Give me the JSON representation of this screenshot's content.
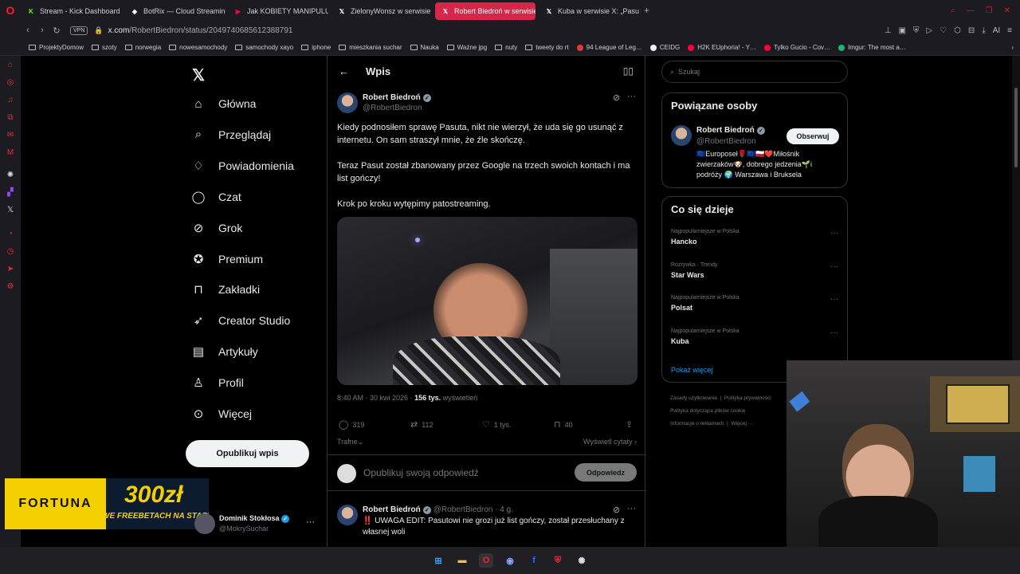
{
  "browser": {
    "tabs": [
      {
        "title": "Stream - Kick Dashboard",
        "icon": "kick-icon",
        "color": "#53fc18",
        "glyph": "K"
      },
      {
        "title": "BotRix — Cloud Streaming",
        "icon": "botrix-icon",
        "color": "#ffffff",
        "glyph": "◈"
      },
      {
        "title": "Jak KOBIETY MANIPULU…",
        "icon": "youtube-icon",
        "color": "#ff0033",
        "glyph": "▶"
      },
      {
        "title": "ZielonyWonsz w serwisie",
        "icon": "x-icon",
        "color": "#ffffff",
        "glyph": "𝕏"
      },
      {
        "title": "Robert Biedroń w serwisie",
        "icon": "x-icon",
        "color": "#ffffff",
        "glyph": "𝕏"
      },
      {
        "title": "Kuba w serwisie X: „Pasut",
        "icon": "x-icon",
        "color": "#ffffff",
        "glyph": "𝕏"
      }
    ],
    "vpn": "VPN",
    "url_host": "x.com",
    "url_path": "/RobertBiedron/status/2049740685612388791",
    "ai_label": "AI",
    "bookmarks": [
      {
        "label": "ProjektyDomow",
        "kind": "folder"
      },
      {
        "label": "szoty",
        "kind": "folder"
      },
      {
        "label": "norwegia",
        "kind": "folder"
      },
      {
        "label": "nowesamochody",
        "kind": "folder"
      },
      {
        "label": "samochody xayo",
        "kind": "folder"
      },
      {
        "label": "iphone",
        "kind": "folder"
      },
      {
        "label": "mieszkania suchar",
        "kind": "folder"
      },
      {
        "label": "Nauka",
        "kind": "folder"
      },
      {
        "label": "Ważne jpg",
        "kind": "folder"
      },
      {
        "label": "nuty",
        "kind": "folder"
      },
      {
        "label": "tweety do rt",
        "kind": "folder"
      },
      {
        "label": "94 League of Leg…",
        "kind": "site",
        "color": "#e03a3a"
      },
      {
        "label": "CEIDG",
        "kind": "site",
        "color": "#f0f0f0"
      },
      {
        "label": "H2K EUphoria! - Y…",
        "kind": "site",
        "color": "#ff0033"
      },
      {
        "label": "Tylko Gucio - Cov…",
        "kind": "site",
        "color": "#ff0033"
      },
      {
        "label": "Imgur: The most a…",
        "kind": "site",
        "color": "#1bb76e"
      }
    ]
  },
  "nav": {
    "items": [
      {
        "label": "Główna",
        "icon": "home-icon",
        "glyph": "⌂"
      },
      {
        "label": "Przeglądaj",
        "icon": "search-icon",
        "glyph": "⌕"
      },
      {
        "label": "Powiadomienia",
        "icon": "bell-icon",
        "glyph": "♢"
      },
      {
        "label": "Czat",
        "icon": "chat-icon",
        "glyph": "◯"
      },
      {
        "label": "Grok",
        "icon": "grok-icon",
        "glyph": "⊘"
      },
      {
        "label": "Premium",
        "icon": "premium-icon",
        "glyph": "✪"
      },
      {
        "label": "Zakładki",
        "icon": "bookmark-icon",
        "glyph": "⊓"
      },
      {
        "label": "Creator Studio",
        "icon": "rocket-icon",
        "glyph": "➶"
      },
      {
        "label": "Artykuły",
        "icon": "article-icon",
        "glyph": "▤"
      },
      {
        "label": "Profil",
        "icon": "profile-icon",
        "glyph": "♙"
      },
      {
        "label": "Więcej",
        "icon": "more-icon",
        "glyph": "⊙"
      }
    ],
    "post_button": "Opublikuj wpis",
    "account_name": "Dominik Stokłosa",
    "account_handle": "@MokrySuchar"
  },
  "ad": {
    "brand": "FORTUNA",
    "amount": "300zł",
    "tagline": "WE FREEBETACH NA START"
  },
  "post": {
    "header_title": "Wpis",
    "author_name": "Robert Biedroń",
    "author_handle": "@RobertBiedron",
    "paragraphs": [
      "Kiedy podnosiłem sprawę Pasuta, nikt nie wierzył, że uda się go usunąć z internetu. On sam straszył mnie, że źle skończę.",
      "Teraz Pasut został zbanowany przez Google na trzech swoich kontach i ma list gończy!",
      "Krok po kroku wytępimy patostreaming."
    ],
    "timestamp": "8:40 AM · 30 kwi 2026 · ",
    "views_count": "156 tys.",
    "views_label": " wyświetleń",
    "replies": "319",
    "reposts": "112",
    "likes": "1 tys.",
    "bookmarks": "40",
    "sort_label": "Trafne",
    "quotes_link": "Wyświetl cytaty",
    "reply_placeholder": "Opublikuj swoją odpowiedź",
    "reply_button": "Odpowiedz",
    "reply_author": "Robert Biedroń",
    "reply_handle_time": "@RobertBiedron · 4 g.",
    "reply_text": "‼️ UWAGA EDIT: Pasutowi nie grozi już list gończy, został przesłuchany z własnej woli"
  },
  "sidebar": {
    "search_placeholder": "Szukaj",
    "related_title": "Powiązane osoby",
    "related_name": "Robert Biedroń",
    "related_handle": "@RobertBiedron",
    "follow_label": "Obserwuj",
    "related_bio": "🇪🇺Europoseł🌹🇪🇺🇵🇱❤️Miłośnik zwierzaków🐶, dobrego jedzenia🌱i podróży 🌍 Warszawa i Bruksela",
    "trends_title": "Co się dzieje",
    "trends": [
      {
        "context": "Najpopularniejsze w Polska",
        "name": "Hancko"
      },
      {
        "context": "Rozrywka · Trendy",
        "name": "Star Wars"
      },
      {
        "context": "Najpopularniejsze w Polska",
        "name": "Polsat"
      },
      {
        "context": "Najpopularniejsze w Polska",
        "name": "Kuba"
      }
    ],
    "show_more": "Pokaż więcej",
    "footer": [
      "Zasady użytkowania",
      "Polityka prywatności",
      "Polityka dotycząca plików cookie",
      "Informacje o reklamach",
      "Więcej ···"
    ]
  },
  "colors": {
    "accent": "#1d9bf0",
    "active_tab": "#d6264a",
    "fortuna": "#f5d000"
  }
}
